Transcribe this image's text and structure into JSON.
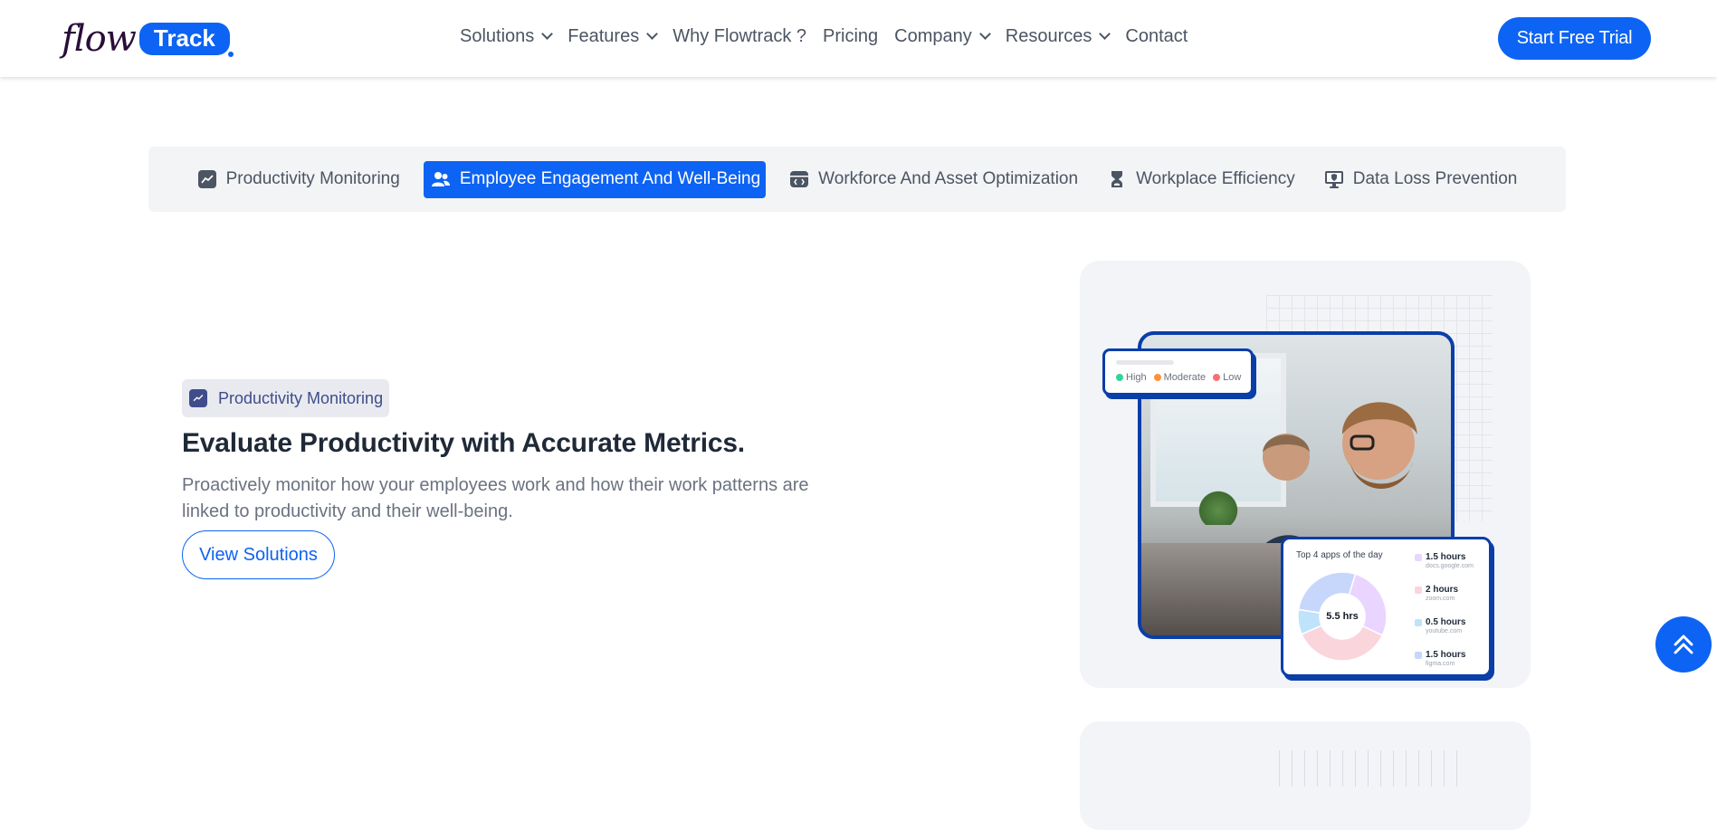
{
  "header": {
    "logo": {
      "flow": "flow",
      "track": "Track"
    },
    "nav": [
      {
        "label": "Solutions",
        "dropdown": true
      },
      {
        "label": "Features",
        "dropdown": true
      },
      {
        "label": "Why Flowtrack ?",
        "dropdown": false
      },
      {
        "label": "Pricing",
        "dropdown": false
      },
      {
        "label": "Company",
        "dropdown": true
      },
      {
        "label": "Resources",
        "dropdown": true
      },
      {
        "label": "Contact",
        "dropdown": false
      }
    ],
    "cta": "Start Free Trial"
  },
  "tabs": [
    {
      "label": "Productivity Monitoring",
      "icon": "chart-trend-icon",
      "active": false
    },
    {
      "label": "Employee Engagement And Well-Being",
      "icon": "users-icon",
      "active": true
    },
    {
      "label": "Workforce And Asset Optimization",
      "icon": "code-window-icon",
      "active": false
    },
    {
      "label": "Workplace Efficiency",
      "icon": "hourglass-icon",
      "active": false
    },
    {
      "label": "Data Loss Prevention",
      "icon": "monitor-shield-icon",
      "active": false
    }
  ],
  "section": {
    "pill": "Productivity Monitoring",
    "headline": "Evaluate Productivity with Accurate Metrics.",
    "description": "Proactively monitor how your employees work and how their work patterns are linked to productivity and their well-being.",
    "button": "View Solutions"
  },
  "illustration": {
    "legend": [
      {
        "label": "High",
        "color": "#34d399"
      },
      {
        "label": "Moderate",
        "color": "#fb923c"
      },
      {
        "label": "Low",
        "color": "#f87171"
      }
    ],
    "apps_card": {
      "title": "Top 4 apps of the day",
      "total": "5.5 hrs",
      "apps": [
        {
          "hours": "1.5 hours",
          "site": "docs.google.com",
          "color": "#e9d5ff",
          "value": 1.5
        },
        {
          "hours": "2 hours",
          "site": "zoom.com",
          "color": "#fbd5dc",
          "value": 2
        },
        {
          "hours": "0.5 hours",
          "site": "youtube.com",
          "color": "#bfe3fb",
          "value": 0.5
        },
        {
          "hours": "1.5 hours",
          "site": "figma.com",
          "color": "#c7d7fb",
          "value": 1.5
        }
      ]
    }
  },
  "colors": {
    "brand": "#0d63f3",
    "navy": "#0a3ea8",
    "text": "#1f2937",
    "muted": "#6b7280"
  }
}
